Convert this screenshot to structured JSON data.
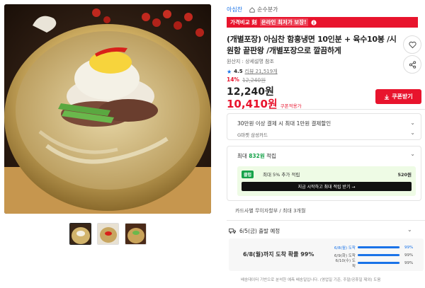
{
  "seller": {
    "name": "아심찬",
    "badge": "순수분가"
  },
  "promo": {
    "prefix": "가격비교 刻",
    "highlight": "온라인 최저가 보장!",
    "info_icon": "info-icon"
  },
  "product": {
    "title": "(개별포장) 아심찬 함흥냉면 10인분 + 육수10봉 /시원함 끝판왕 /개별포장으로 깔끔하게",
    "origin": "원산지 : 상세설명 참조",
    "rating": "4.5",
    "review_count": "리뷰 21,519개",
    "discount_pct": "14%",
    "original_price": "12,240원",
    "price": "12,240원",
    "coupon_price": "10,410원",
    "coupon_label": "쿠폰적용가",
    "coupon_button": "쿠폰받기"
  },
  "card_benefit": {
    "line1": "30만원 이상 결제 시 최대 1만원 결제할인",
    "line2": "G마켓 삼성카드"
  },
  "rewards": {
    "head_prefix": "최대",
    "head_amount": "832원",
    "head_suffix": "적립",
    "badge": "클럽",
    "desc": "최대 5% 추가 적립",
    "amount": "520원",
    "cta": "지금 시작하고 최대 적립 받기 →"
  },
  "installment": "카드사별 무이자할부 / 최대 3개월",
  "shipping": {
    "label": "6/5(금) 출발 예정",
    "arrival": "6/8(월)까지 도착 확률 99%",
    "rows": [
      {
        "date": "6/8(월) 도착",
        "pct": "99%",
        "value": 0.99
      },
      {
        "date": "6/9(화) 도착",
        "pct": "99%",
        "value": 0.99
      },
      {
        "date": "6/10(수) 도착",
        "pct": "99%",
        "value": 0.99
      }
    ],
    "note": "배송데이터 기반으로 분석한 예측 배송일입니다. (영업일 기준, 주말/공휴일 제외) 도움"
  },
  "icons": {
    "favorite": "heart-icon",
    "share": "share-icon",
    "star": "star-icon",
    "truck": "truck-icon"
  }
}
